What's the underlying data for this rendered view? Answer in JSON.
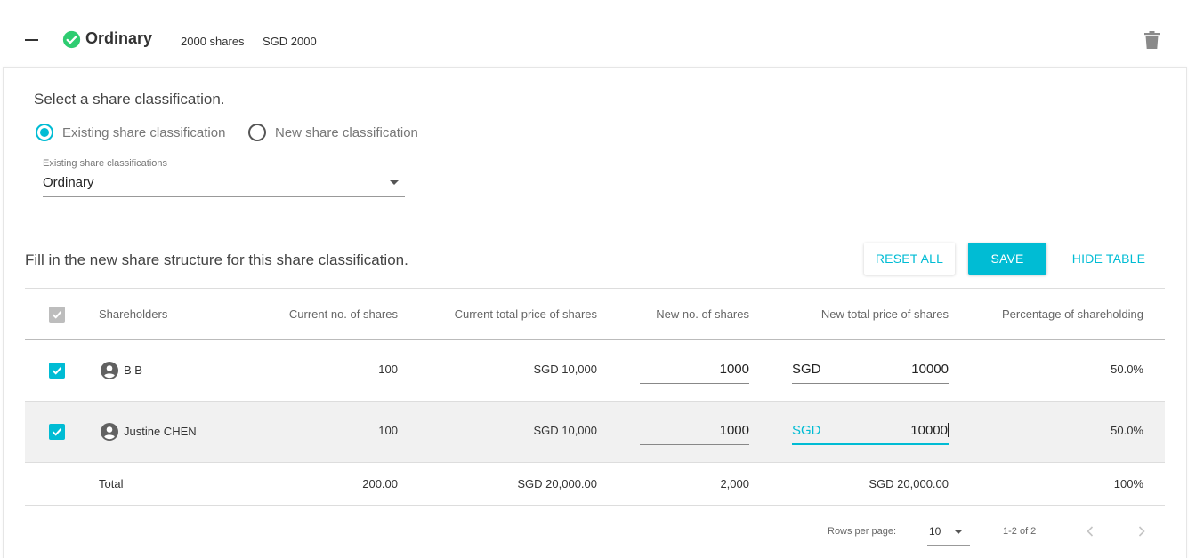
{
  "section": {
    "title": "Ordinary",
    "shares": "2000 shares",
    "amount": "SGD 2000"
  },
  "classification": {
    "prompt": "Select a share classification.",
    "options": [
      "Existing share classification",
      "New share classification"
    ],
    "selected": "Existing share classification",
    "dropdown_caption": "Existing share classifications",
    "dropdown_value": "Ordinary"
  },
  "structure": {
    "prompt": "Fill in the new share structure for this share classification.",
    "reset_label": "RESET ALL",
    "save_label": "SAVE",
    "hide_label": "HIDE TABLE"
  },
  "table": {
    "columns": [
      "Shareholders",
      "Current no. of shares",
      "Current total price of shares",
      "New no. of shares",
      "New total price of shares",
      "Percentage of shareholding"
    ],
    "rows": [
      {
        "name": "B B",
        "current_shares": "100",
        "current_price": "SGD 10,000",
        "new_shares": "1000",
        "currency": "SGD",
        "new_price": "10000",
        "percentage": "50.0%",
        "checked": true
      },
      {
        "name": "Justine CHEN",
        "current_shares": "100",
        "current_price": "SGD 10,000",
        "new_shares": "1000",
        "currency": "SGD",
        "new_price": "10000",
        "percentage": "50.0%",
        "checked": true
      }
    ],
    "total": {
      "label": "Total",
      "current_shares": "200.00",
      "current_price": "SGD 20,000.00",
      "new_shares": "2,000",
      "new_price": "SGD 20,000.00",
      "percentage": "100%"
    }
  },
  "pagination": {
    "rows_per_page_label": "Rows per page:",
    "rows_per_page": "10",
    "range": "1-2 of 2"
  },
  "colors": {
    "accent": "#00bcd4",
    "success": "#2ecc71"
  }
}
